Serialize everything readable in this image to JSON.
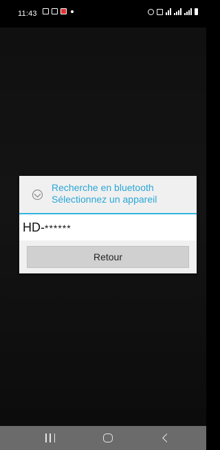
{
  "status_bar": {
    "time": "11:43",
    "left_icons": [
      "notification-icon",
      "gallery-icon",
      "app-icon"
    ],
    "right_icons": [
      "alarm-icon",
      "mute-icon",
      "wifi-icon",
      "signal-icon",
      "signal-icon",
      "battery-icon"
    ]
  },
  "dialog": {
    "title_line1": "Recherche en bluetooth",
    "title_line2": "Sélectionnez un appareil",
    "accent_color": "#2fb5e0",
    "devices": [
      {
        "prefix": "HD-",
        "masked": "******"
      }
    ],
    "back_label": "Retour"
  },
  "nav_bar": {
    "buttons": [
      "recents-icon",
      "home-icon",
      "back-icon"
    ]
  }
}
